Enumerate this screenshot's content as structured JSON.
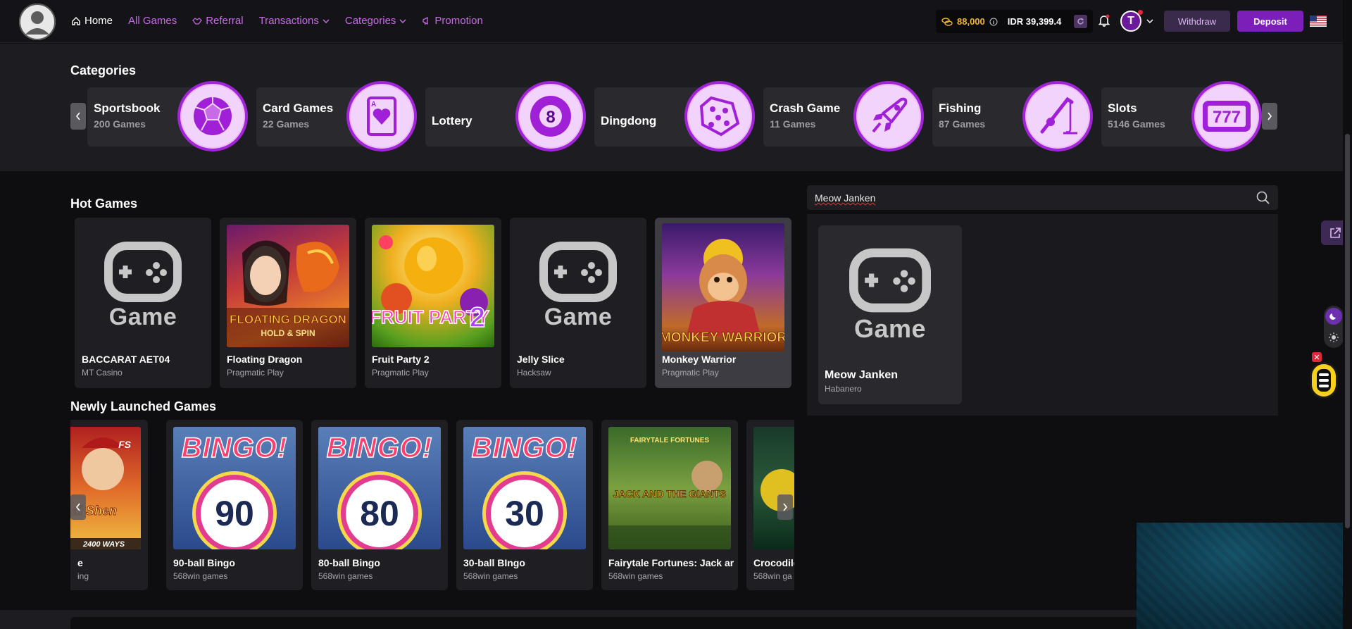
{
  "header": {
    "nav": [
      {
        "label": "Home",
        "icon": "home-icon"
      },
      {
        "label": "All Games"
      },
      {
        "label": "Referral",
        "icon": "handshake-icon"
      },
      {
        "label": "Transactions",
        "icon": "chevron-down-icon"
      },
      {
        "label": "Categories",
        "icon": "chevron-down-icon"
      },
      {
        "label": "Promotion",
        "icon": "megaphone-icon"
      }
    ],
    "coins": "88,000",
    "balance": "IDR 39,399.4",
    "user_initial": "T",
    "withdraw_label": "Withdraw",
    "deposit_label": "Deposit"
  },
  "categories": {
    "title": "Categories",
    "items": [
      {
        "name": "Sportsbook",
        "count": "200 Games",
        "icon": "soccer-ball-icon"
      },
      {
        "name": "Card Games",
        "count": "22 Games",
        "icon": "playing-card-icon"
      },
      {
        "name": "Lottery",
        "count": "",
        "icon": "lottery-ball-icon"
      },
      {
        "name": "Dingdong",
        "count": "",
        "icon": "dice-icon"
      },
      {
        "name": "Crash Game",
        "count": "11 Games",
        "icon": "rocket-icon"
      },
      {
        "name": "Fishing",
        "count": "87 Games",
        "icon": "fishing-rod-icon"
      },
      {
        "name": "Slots",
        "count": "5146 Games",
        "icon": "slot-machine-icon"
      }
    ]
  },
  "hot_games": {
    "title": "Hot Games",
    "items": [
      {
        "name": "BACCARAT AET04",
        "provider": "MT Casino",
        "thumb": "placeholder"
      },
      {
        "name": "Floating Dragon",
        "provider": "Pragmatic Play",
        "thumb": "floating-dragon"
      },
      {
        "name": "Fruit Party 2",
        "provider": "Pragmatic Play",
        "thumb": "fruit-party"
      },
      {
        "name": "Jelly Slice",
        "provider": "Hacksaw",
        "thumb": "placeholder"
      },
      {
        "name": "Monkey Warrior",
        "provider": "Pragmatic Play",
        "thumb": "monkey-warrior"
      }
    ],
    "placeholder_label": "Game"
  },
  "new_games": {
    "title": "Newly Launched Games",
    "items": [
      {
        "name": "e",
        "provider": "ing",
        "thumb": "cai-shen"
      },
      {
        "name": "90-ball Bingo",
        "provider": "568win games",
        "thumb": "bingo",
        "ball": "90"
      },
      {
        "name": "80-ball Bingo",
        "provider": "568win games",
        "thumb": "bingo",
        "ball": "80"
      },
      {
        "name": "30-ball BIngo",
        "provider": "568win games",
        "thumb": "bingo",
        "ball": "30"
      },
      {
        "name": "Fairytale Fortunes: Jack ar",
        "provider": "568win games",
        "thumb": "jack-giants"
      },
      {
        "name": "Crocodile",
        "provider": "568win ga",
        "thumb": "crocodile"
      }
    ],
    "partial_texts": {
      "cai_shen_brand": "FS",
      "cai_shen_title": "ai Shen",
      "cai_shen_ways": "2400 WAYS",
      "bingo_word": "BINGO!"
    }
  },
  "search": {
    "value": "Meow Janken",
    "result": {
      "name": "Meow Janken",
      "provider": "Habanero",
      "thumb_label": "Game"
    }
  },
  "thumb_texts": {
    "floating_dragon": "FLOATING DRAGON",
    "floating_dragon_sub": "HOLD & SPIN",
    "fruit_party": "FRUIT PARTY",
    "fruit_party_num": "2",
    "monkey_warrior": "MONKEY WARRIOR",
    "jack_giants_top": "FAIRYTALE FORTUNES",
    "jack_giants_main": "JACK AND THE GIANTS"
  },
  "colors": {
    "accent": "#c86be7",
    "deposit": "#7b1fb8",
    "coin": "#f0b330",
    "category_ring": "#a224d8"
  }
}
